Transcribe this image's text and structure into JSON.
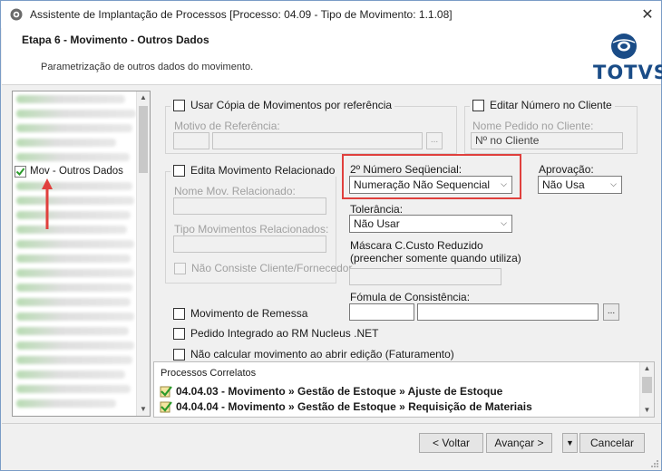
{
  "window": {
    "title": "Assistente de Implantação de Processos [Processo: 04.09 - Tipo de Movimento: 1.1.08]",
    "close_glyph": "✕"
  },
  "header": {
    "step_title": "Etapa 6 - Movimento - Outros Dados",
    "description": "Parametrização de outros dados do movimento.",
    "logo_text": "TOTVS",
    "logo_color": "#1a4c87"
  },
  "sidebar": {
    "active_item": "Mov - Outros Dados",
    "active_icon": "green-check-icon"
  },
  "copia": {
    "checkbox_label": "Usar Cópia de Movimentos por referência",
    "motivo_label": "Motivo de Referência:",
    "ellipsis": "..."
  },
  "editar_numero": {
    "checkbox_label": "Editar Número no Cliente",
    "pedido_label": "Nome Pedido no Cliente:",
    "pedido_value": "Nº no Cliente"
  },
  "relacionado": {
    "checkbox_label": "Edita Movimento Relacionado",
    "nome_label": "Nome Mov. Relacionado:",
    "tipos_label": "Tipo Movimentos Relacionados:",
    "nao_consiste_label": "Não Consiste Cliente/Fornecedor"
  },
  "numero_seq": {
    "label": "2º Número Seqüencial:",
    "value": "Numeração Não Sequencial",
    "highlight_color": "#e0403d"
  },
  "aprovacao": {
    "label": "Aprovação:",
    "value": "Não Usa"
  },
  "tolerancia": {
    "label": "Tolerância:",
    "value": "Não Usar"
  },
  "mascara": {
    "label1": "Máscara C.Custo Reduzido",
    "label2": "(preencher somente quando utiliza)"
  },
  "formula": {
    "label": "Fómula de Consistência:",
    "ellipsis": "..."
  },
  "checkboxes": {
    "remessa": "Movimento de Remessa",
    "integrado": "Pedido Integrado ao RM Nucleus .NET",
    "nao_calcular": "Não calcular movimento ao abrir edição (Faturamento)"
  },
  "correlatos": {
    "header": "Processos Correlatos",
    "items": [
      "04.04.03 - Movimento » Gestão de Estoque » Ajuste de Estoque",
      "04.04.04 - Movimento » Gestão de Estoque » Requisição de Materiais"
    ]
  },
  "footer": {
    "voltar": "< Voltar",
    "avancar": "Avançar >",
    "split": "▼",
    "cancelar": "Cancelar"
  }
}
